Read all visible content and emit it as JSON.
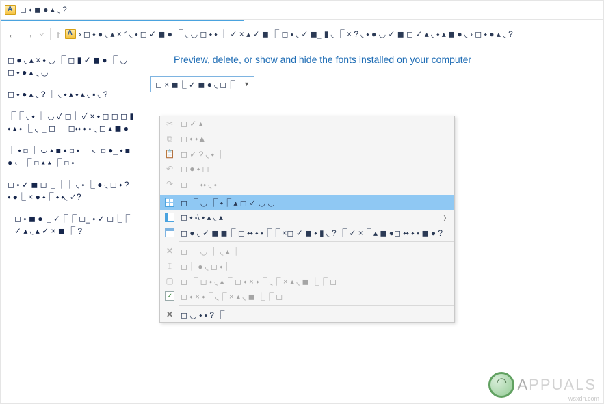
{
  "window": {
    "title": "◻ ⬩ ◼ ● ▴ ◟ ?"
  },
  "nav": {
    "back_enabled": true,
    "forward_enabled": false,
    "path_text": "› ◻ ⬩ ● ◟ ▴ × ◜ ◟ ⬩ ◻ ✓ ◼ ● ⎾ ◟ ◡ ◻ ⬩ ⬩ ⎿ ✓ × ▴ ✓ ◼ ⎾ ◻ ⬩ ◟ ✓ ◼_ ▮ ◟ ⎾ × ? ◟ ⬩ ● ◡ ✓ ◼ ◻ ✓ ▴ ◟ ⬩ ▴ ◼ ● ◟ › ◻ ⬩ ● ▴ ◟ ?"
  },
  "sidebar": {
    "items": [
      "◻ ● ◟ ▴ × ⬩ ◡ ⎾ ◻ ▮ ✓ ◼ ● ⎾ ◡\n◻ ⬩ ● ▴ ◟ ◡",
      "◻ ⬩ ● ▴ ◟ ? ⎾ ◟ ⬩ ▴ ⬩ ▴ ◟ ▪ ◟ ?",
      "⎾⎾ ◟ ⬩ ⎿ ◡ ✓ ◻⎿ ✓ × ⬩\n◻ ◻ ◻ ▮ ⬩ ▴ ⬩ ⎿ ◟⎿ ◻ ⎾ ◻⬩⬩\n⬩ ⬩ ◟ ◻ ▴ ◼ ●",
      "⎾ ⬩ ◻ ⎾ ◡ ▴ ◼ ▴ ◻ ⬩ ⎿ ◟\n◻ ●_ ⬩ ◼ ● ◟ ⎾ ◻ ▴ ▴ ⎾ ◻ ⬩",
      "◻ ⬩ ✓ ◼ ◻⎿ ⎾⎾ ◟ ⬩ ⎿ ● ◟ ◻ ⬩\n? ⬩ ●⎿ × ● ⬩⎾ ⬩ ⬩◟ ✓?",
      "◻ ⬩ ◼ ●⎿ ✓⎾⎾ ◻_ ⬩ ✓\n◻⎿⎾ ✓ ▴ ◟ ▴ ✓ × ◼ ⎾ ?"
    ]
  },
  "main": {
    "heading": "Preview, delete, or show and hide the fonts installed on your computer",
    "toolbar_button": "◻ × ◼⎿ ✓ ◼ ● ◟ ◻⎾"
  },
  "context_menu": {
    "items": [
      {
        "icon": "cut-icon",
        "label": "◻ ✓ ▴",
        "state": "disabled"
      },
      {
        "icon": "copy-icon",
        "label": "◻ ⬩ ⬩▲",
        "state": "disabled"
      },
      {
        "icon": "paste-icon",
        "label": "◻ ✓ ? ◟ ⬩ ⎾",
        "state": "disabled"
      },
      {
        "icon": "undo-icon",
        "label": "◻ ● ⬩ ◻",
        "state": "disabled"
      },
      {
        "icon": "redo-icon",
        "label": "◻ ⎾ ⬩⬩ ◟ ⬩",
        "state": "disabled"
      },
      {
        "type": "divider"
      },
      {
        "icon": "select-all-icon",
        "label": "◻ ⎾ ◡ ⎾ ⬩⎾ ▴ ◻ ✓ ◡ ◡",
        "state": "highlight"
      },
      {
        "icon": "layout-icon",
        "label": "◻ ⬩ ⬞\\ ⬩ ▴ ◟ ▴",
        "state": "enabled",
        "submenu": true
      },
      {
        "icon": "details-icon",
        "label": "◻ ● ◟ ✓ ◼ ◼⎾ ◻ ⬩⬩ ⬩ ⬩⎾⎾ ×◻ ✓ ◼ ⬩ ▮ ◟ ? ⎾ ✓ ×⎾ ▴ ◼ ●◻ ⬩⬩ ⬩ ⬩ ◼ ● ?",
        "state": "enabled"
      },
      {
        "type": "divider"
      },
      {
        "icon": "delete-icon",
        "label": "◻ ⎾ ◡ ⎾ ◟ ▴ ⎾",
        "state": "disabled"
      },
      {
        "icon": "rename-icon",
        "label": "◻⎾ ● ◟ ◻ ⬩⎾",
        "state": "disabled"
      },
      {
        "icon": "remove-prop-icon",
        "label": "◻ ⎾ ◻ ⬩ ◟ ▴⎾ ◻ ⬩ × ⬩⎾ ◟⎾ × ▴ ◟ ◼ ⎿⎾ ◻",
        "state": "disabled"
      },
      {
        "icon": "properties-icon",
        "label": "◻ ⬩ × ⬩⎾ ◟⎾ × ▴ ◟ ◼ ⎿⎾ ◻",
        "state": "disabled"
      },
      {
        "type": "divider"
      },
      {
        "icon": "close-icon",
        "label": "◻ ◡ ⬩ ⬩ ? ⎾",
        "state": "enabled"
      }
    ]
  },
  "watermark": {
    "text_prefix": "A",
    "text_suffix": "PPUALS"
  },
  "credit": "wsxdn.com"
}
